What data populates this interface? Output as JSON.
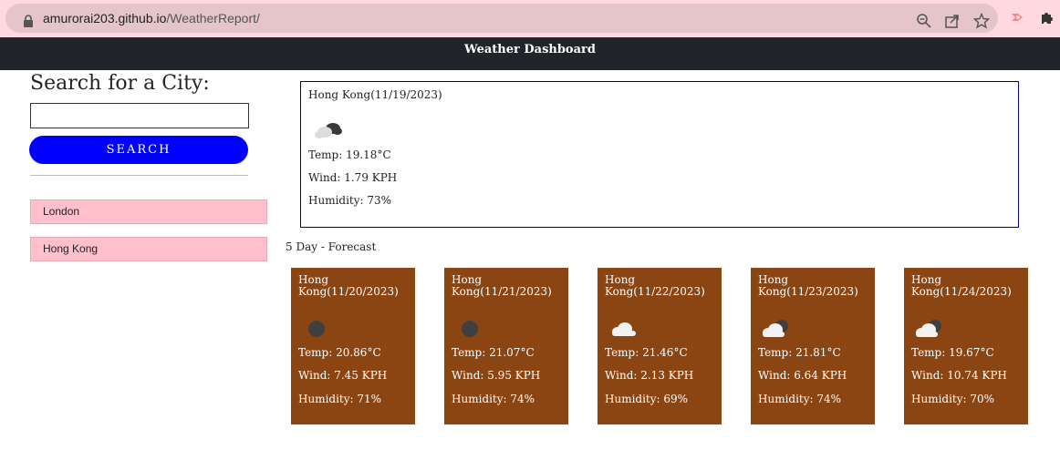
{
  "browser": {
    "url_host": "amurorai203.github.io",
    "url_path": "/WeatherReport/"
  },
  "header": {
    "title": "Weather Dashboard"
  },
  "sidebar": {
    "search_title": "Search for a City:",
    "search_value": "",
    "search_button": "SEARCH",
    "history": [
      "London",
      "Hong Kong"
    ]
  },
  "current": {
    "heading": "Hong Kong(11/19/2023)",
    "icon": "broken-clouds",
    "temp": "Temp: 19.18°C",
    "wind": "Wind: 1.79 KPH",
    "humidity": "Humidity: 73%"
  },
  "forecast_title": "5 Day - Forecast",
  "forecast": [
    {
      "heading": "Hong Kong(11/20/2023)",
      "icon": "clear-night",
      "temp": "Temp: 20.86°C",
      "wind": "Wind: 7.45 KPH",
      "humidity": "Humidity: 71%"
    },
    {
      "heading": "Hong Kong(11/21/2023)",
      "icon": "clear-night",
      "temp": "Temp: 21.07°C",
      "wind": "Wind: 5.95 KPH",
      "humidity": "Humidity: 74%"
    },
    {
      "heading": "Hong Kong(11/22/2023)",
      "icon": "cloud",
      "temp": "Temp: 21.46°C",
      "wind": "Wind: 2.13 KPH",
      "humidity": "Humidity: 69%"
    },
    {
      "heading": "Hong Kong(11/23/2023)",
      "icon": "night-clouds",
      "temp": "Temp: 21.81°C",
      "wind": "Wind: 6.64 KPH",
      "humidity": "Humidity: 74%"
    },
    {
      "heading": "Hong Kong(11/24/2023)",
      "icon": "night-clouds",
      "temp": "Temp: 19.67°C",
      "wind": "Wind: 10.74 KPH",
      "humidity": "Humidity: 70%"
    }
  ],
  "colors": {
    "header_bg": "#212529",
    "search_button": "#0000ff",
    "history_bg": "#ffc0cb",
    "card_bg": "#8b4513",
    "current_border": "#00008b"
  }
}
